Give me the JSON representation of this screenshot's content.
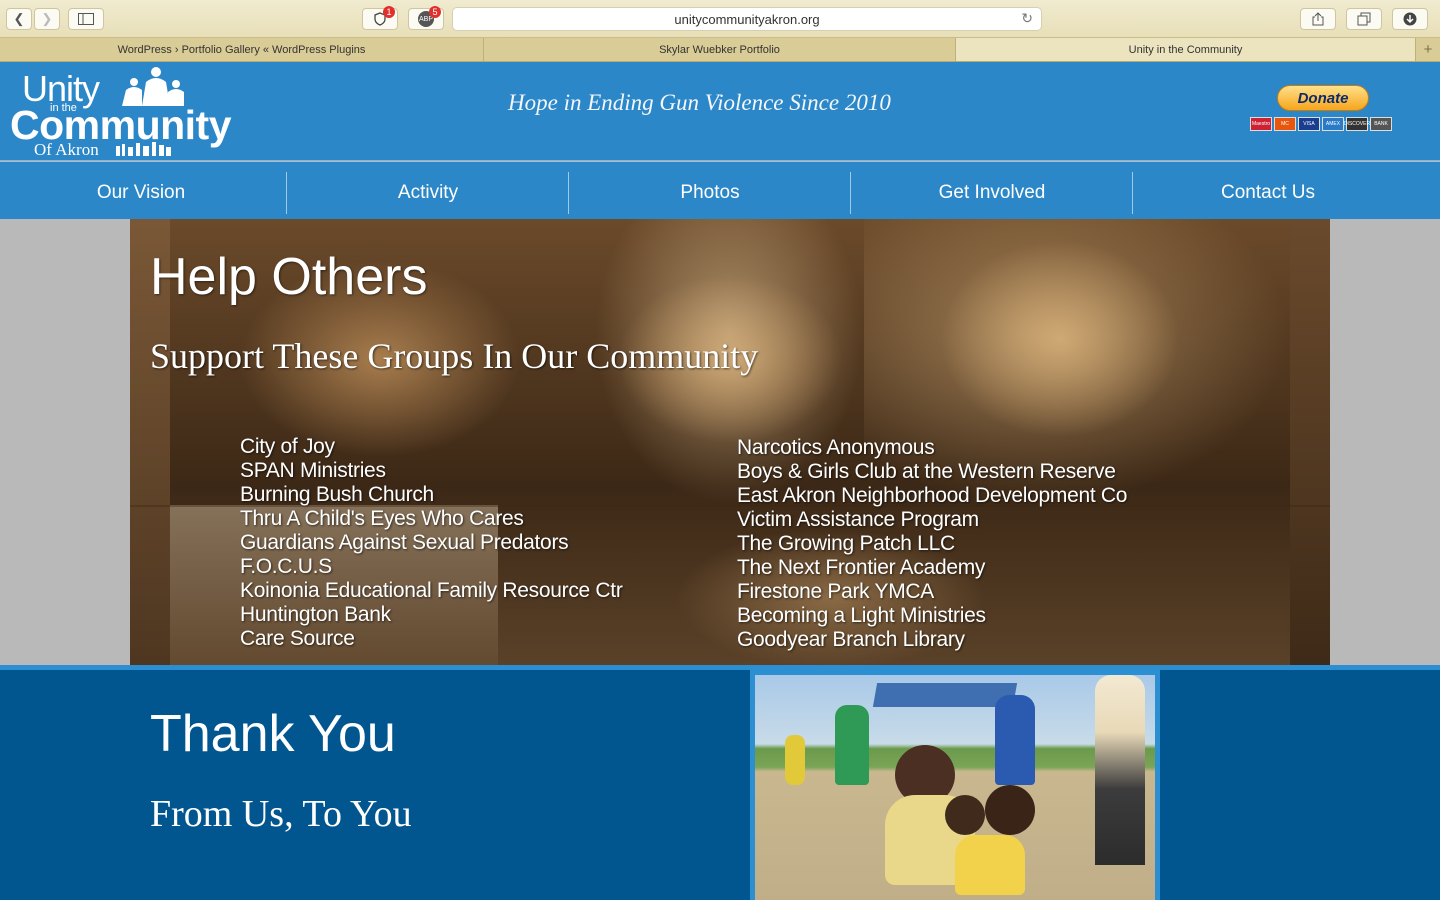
{
  "browser": {
    "url": "unitycommunityakron.org",
    "privacy_badge": "1",
    "adblock_label": "ABP",
    "adblock_badge": "5",
    "tabs": [
      {
        "title": "WordPress › Portfolio Gallery « WordPress Plugins"
      },
      {
        "title": "Skylar Wuebker Portfolio"
      },
      {
        "title": "Unity in the Community"
      }
    ]
  },
  "header": {
    "logo": {
      "line1": "Unity",
      "line2": "in the",
      "line3": "Community",
      "line4": "Of Akron"
    },
    "tagline": "Hope in Ending Gun Violence Since 2010",
    "donate_label": "Donate",
    "cards": [
      {
        "name": "Maestro",
        "color": "#cc2233"
      },
      {
        "name": "MC",
        "color": "#e8560e"
      },
      {
        "name": "VISA",
        "color": "#1a3d8f"
      },
      {
        "name": "AMEX",
        "color": "#2a7ac7"
      },
      {
        "name": "DISCOVER",
        "color": "#333333"
      },
      {
        "name": "BANK",
        "color": "#555555"
      }
    ]
  },
  "nav": {
    "items": [
      "Our Vision",
      "Activity",
      "Photos",
      "Get Involved",
      "Contact Us"
    ]
  },
  "hero": {
    "title": "Help Others",
    "subtitle": "Support These Groups In Our Community",
    "groups_left": [
      "City of Joy",
      "SPAN Ministries",
      "Burning Bush Church",
      "Thru A Child's Eyes Who Cares",
      "Guardians Against Sexual Predators",
      "F.O.C.U.S",
      "Koinonia Educational Family Resource Ctr",
      "Huntington Bank",
      "Care Source"
    ],
    "groups_right": [
      "Narcotics Anonymous",
      "Boys & Girls Club at the Western Reserve",
      "East Akron Neighborhood Development Co",
      "Victim Assistance Program",
      "The Growing Patch LLC",
      "The Next Frontier Academy",
      "Firestone Park YMCA",
      "Becoming a Light Ministries",
      "Goodyear Branch Library"
    ]
  },
  "thanks": {
    "title": "Thank You",
    "subtitle": "From Us, To You"
  },
  "colors": {
    "brand_blue": "#2b87c8",
    "dark_blue": "#02568f",
    "donate_orange": "#f7a51c"
  }
}
